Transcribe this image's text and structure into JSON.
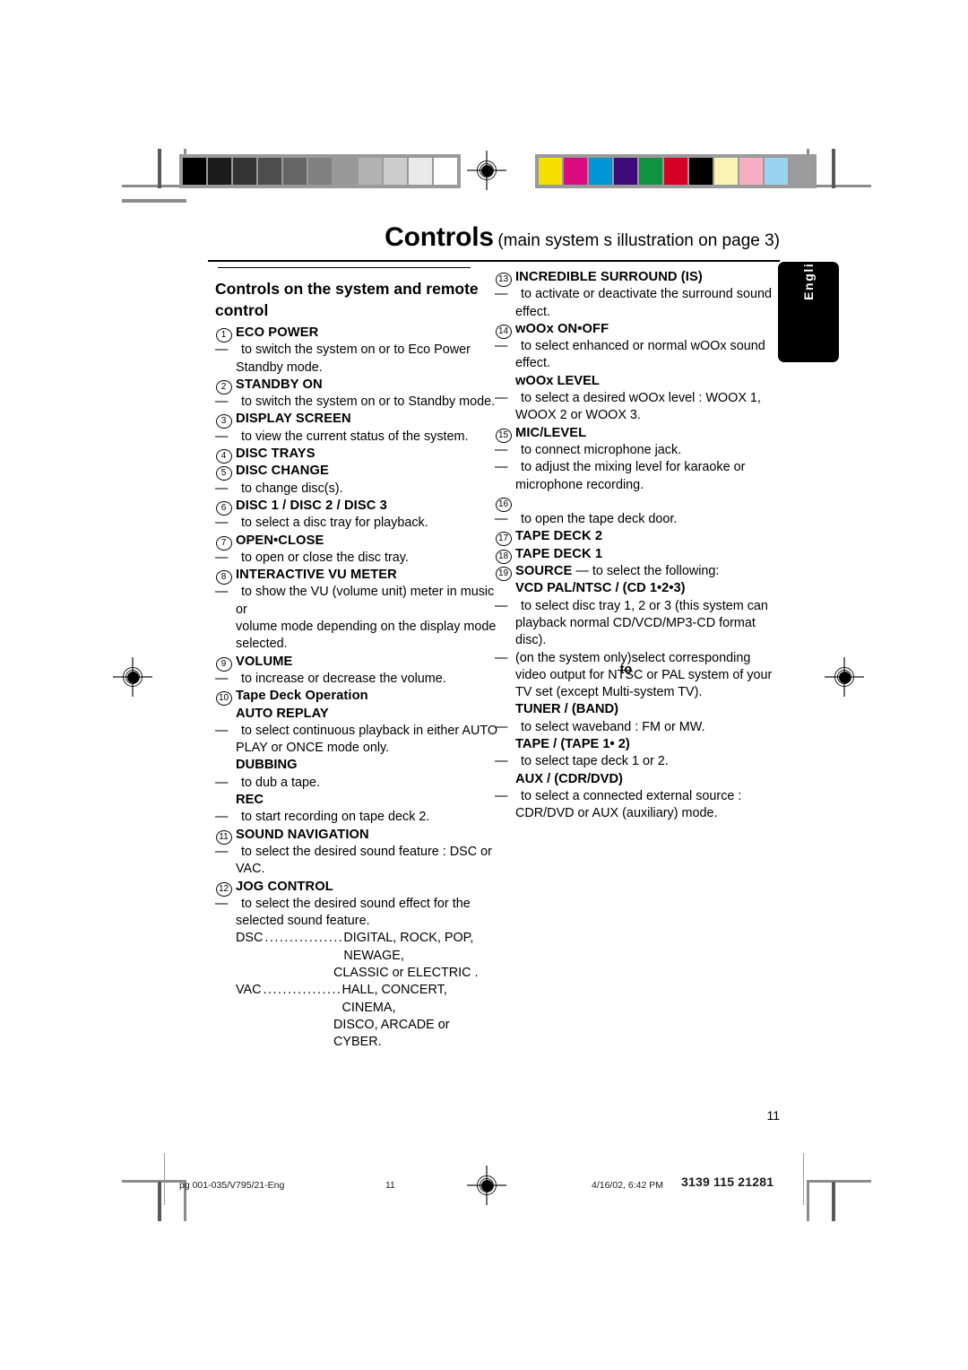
{
  "header": {
    "title_main": "Controls",
    "title_sub": "(main system s illustration on page 3)",
    "language_tab": "English"
  },
  "left_column": {
    "section_title": "Controls on the system and remote control",
    "entries": [
      {
        "num": "1",
        "label": "ECO POWER",
        "lines": [
          {
            "type": "dash",
            "text": "to switch the system on or to Eco Power"
          },
          {
            "type": "cont",
            "text": "Standby mode."
          }
        ]
      },
      {
        "num": "2",
        "label": "STANDBY ON",
        "lines": [
          {
            "type": "dash",
            "text": "to switch the system on or to Standby mode."
          }
        ]
      },
      {
        "num": "3",
        "label": "DISPLAY SCREEN",
        "lines": [
          {
            "type": "dash",
            "text": "to view the current status of the system."
          }
        ]
      },
      {
        "num": "4",
        "label": "DISC TRAYS",
        "lines": []
      },
      {
        "num": "5",
        "label": "DISC CHANGE",
        "lines": [
          {
            "type": "dash",
            "text": "to change disc(s)."
          }
        ]
      },
      {
        "num": "6",
        "label": "DISC 1 / DISC 2 / DISC 3",
        "lines": [
          {
            "type": "dash",
            "text": "to select a disc tray for playback."
          }
        ]
      },
      {
        "num": "7",
        "label": "OPEN•CLOSE",
        "lines": [
          {
            "type": "dash",
            "text": "to open or close the disc tray."
          }
        ]
      },
      {
        "num": "8",
        "label": "INTERACTIVE VU METER",
        "lines": [
          {
            "type": "dash",
            "text": "to show the VU (volume unit) meter in music or"
          },
          {
            "type": "cont",
            "text": "volume mode depending on the display mode"
          },
          {
            "type": "cont",
            "text": "selected."
          }
        ]
      },
      {
        "num": "9",
        "label": "VOLUME",
        "lines": [
          {
            "type": "dash",
            "text": "to increase or decrease the volume."
          }
        ]
      },
      {
        "num": "10",
        "label": "Tape Deck Operation",
        "lines": []
      },
      {
        "num": "",
        "label": "AUTO REPLAY",
        "lines": [
          {
            "type": "dash",
            "text": "to select continuous playback in either AUTO"
          },
          {
            "type": "cont",
            "text": "PLAY or ONCE mode only."
          }
        ]
      },
      {
        "num": "",
        "label": "DUBBING",
        "lines": [
          {
            "type": "dash",
            "text": "to dub a tape."
          }
        ]
      },
      {
        "num": "",
        "label": "REC",
        "lines": [
          {
            "type": "dash",
            "text": "to start recording on tape deck 2."
          }
        ]
      },
      {
        "num": "11",
        "label": "SOUND NAVIGATION",
        "lines": [
          {
            "type": "dash",
            "text": "to select the desired sound feature : DSC or"
          },
          {
            "type": "cont",
            "text": "VAC."
          }
        ]
      },
      {
        "num": "12",
        "label": "JOG CONTROL",
        "lines": [
          {
            "type": "dash",
            "text": "to select the desired sound effect for the"
          },
          {
            "type": "cont",
            "text": "selected sound feature."
          }
        ]
      }
    ],
    "leaders": [
      {
        "key": "DSC",
        "dots": "....................",
        "value": "DIGITAL, ROCK, POP, NEWAGE,",
        "cont": "CLASSIC or ELECTRIC ."
      },
      {
        "key": "VAC",
        "dots": "....................",
        "value": "HALL, CONCERT, CINEMA,",
        "cont": "DISCO, ARCADE or CYBER."
      }
    ]
  },
  "right_column": {
    "entries": [
      {
        "num": "13",
        "label": "INCREDIBLE SURROUND (IS)",
        "lines": [
          {
            "type": "dash",
            "text": "to activate or deactivate the surround sound"
          },
          {
            "type": "cont",
            "text": "effect."
          }
        ]
      },
      {
        "num": "14",
        "label": "wOOx ON•OFF",
        "lines": [
          {
            "type": "dash",
            "text": "to select enhanced or normal wOOx sound"
          },
          {
            "type": "cont",
            "text": "effect."
          }
        ]
      },
      {
        "num": "",
        "label": "wOOx LEVEL",
        "lines": [
          {
            "type": "dash",
            "text": "to select a desired wOOx level : WOOX 1,"
          },
          {
            "type": "cont",
            "text": "WOOX 2 or WOOX 3."
          }
        ]
      },
      {
        "num": "15",
        "label": "MIC/LEVEL",
        "lines": [
          {
            "type": "dash",
            "text": "to connect microphone jack."
          },
          {
            "type": "dash",
            "text": "to adjust the mixing level for karaoke or"
          },
          {
            "type": "cont",
            "text": "microphone recording."
          }
        ]
      },
      {
        "num": "16",
        "label": "",
        "lines": [
          {
            "type": "dash",
            "text": "to open the tape deck door."
          }
        ]
      },
      {
        "num": "17",
        "label": "TAPE DECK 2",
        "lines": []
      },
      {
        "num": "18",
        "label": "TAPE DECK 1",
        "lines": []
      },
      {
        "num": "19",
        "label": "SOURCE",
        "label_suffix": " — to select the following:",
        "lines": []
      },
      {
        "num": "",
        "label": "VCD PAL/NTSC / (CD 1•2•3)",
        "lines": [
          {
            "type": "dash",
            "text": "to select disc tray 1, 2 or 3 (this system can"
          },
          {
            "type": "cont",
            "text": "playback normal CD/VCD/MP3-CD format"
          },
          {
            "type": "cont",
            "text": "disc)."
          },
          {
            "type": "dash-overlap",
            "text": "(on the system only)select corresponding",
            "overlap_text": "to"
          },
          {
            "type": "cont",
            "text": "video output for NTSC or PAL system of your"
          },
          {
            "type": "cont",
            "text": "TV set (except Multi-system TV)."
          }
        ]
      },
      {
        "num": "",
        "label": "TUNER / (BAND)",
        "lines": [
          {
            "type": "dash",
            "text": "to select waveband : FM or MW."
          }
        ]
      },
      {
        "num": "",
        "label": "TAPE / (TAPE 1• 2)",
        "lines": [
          {
            "type": "dash",
            "text": "to select tape deck 1 or 2."
          }
        ]
      },
      {
        "num": "",
        "label": "AUX / (CDR/DVD)",
        "lines": [
          {
            "type": "dash",
            "text": "to select a connected external source :"
          },
          {
            "type": "cont",
            "text": "CDR/DVD or AUX (auxiliary) mode."
          }
        ]
      }
    ]
  },
  "page_number": "11",
  "footer": {
    "file": "pg 001-035/V795/21-Eng",
    "page": "11",
    "date": "4/16/02, 6:42 PM",
    "code": "3139 115 21281"
  },
  "calibration": {
    "gray_strip": [
      "#000000",
      "#1c1c1c",
      "#333333",
      "#4d4d4d",
      "#666666",
      "#808080",
      "#999999",
      "#b3b3b3",
      "#cccccc",
      "#eaeaea",
      "#ffffff"
    ],
    "color_strip": [
      "#f5e000",
      "#da0a7f",
      "#0096d6",
      "#3d0b7a",
      "#0f9340",
      "#d50023",
      "#000000",
      "#faf5b4",
      "#f6aec4",
      "#9ad3f0",
      "#9c9c9c"
    ]
  }
}
